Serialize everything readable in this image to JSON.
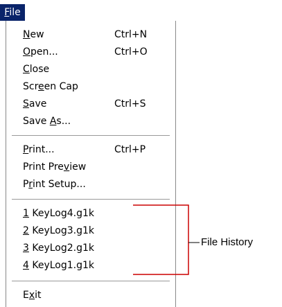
{
  "menu": {
    "title": {
      "pre": "",
      "u": "F",
      "post": "ile"
    },
    "items": [
      {
        "pre": "",
        "u": "N",
        "post": "ew",
        "shortcut": "Ctrl+N"
      },
      {
        "pre": "",
        "u": "O",
        "post": "pen...",
        "shortcut": "Ctrl+O"
      },
      {
        "pre": "",
        "u": "C",
        "post": "lose",
        "shortcut": ""
      },
      {
        "pre": "Scr",
        "u": "e",
        "post": "en Cap",
        "shortcut": ""
      },
      {
        "pre": "",
        "u": "S",
        "post": "ave",
        "shortcut": "Ctrl+S"
      },
      {
        "pre": "Save ",
        "u": "A",
        "post": "s...",
        "shortcut": ""
      },
      {
        "pre": "",
        "u": "P",
        "post": "rint...",
        "shortcut": "Ctrl+P"
      },
      {
        "pre": "Print Pre",
        "u": "v",
        "post": "iew",
        "shortcut": ""
      },
      {
        "pre": "P",
        "u": "r",
        "post": "int Setup...",
        "shortcut": ""
      },
      {
        "pre": "",
        "u": "1",
        "post": " KeyLog4.g1k",
        "shortcut": ""
      },
      {
        "pre": "",
        "u": "2",
        "post": " KeyLog3.g1k",
        "shortcut": ""
      },
      {
        "pre": "",
        "u": "3",
        "post": " KeyLog2.g1k",
        "shortcut": ""
      },
      {
        "pre": "",
        "u": "4",
        "post": " KeyLog1.g1k",
        "shortcut": ""
      },
      {
        "pre": "E",
        "u": "x",
        "post": "it",
        "shortcut": ""
      }
    ]
  },
  "annotation": {
    "label": "File History"
  },
  "colors": {
    "menu_title_bg": "#0a246a",
    "annotation_line": "#cc0000"
  }
}
